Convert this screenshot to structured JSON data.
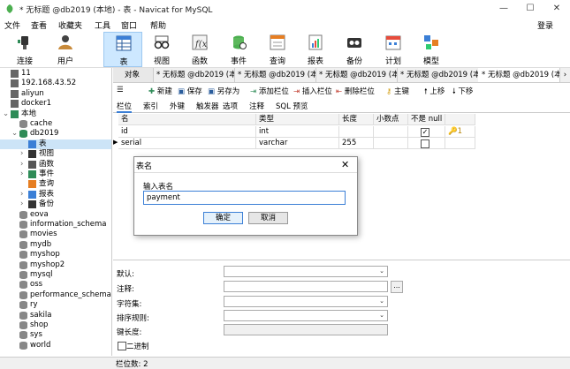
{
  "window": {
    "title": "* 无标题 @db2019 (本地) - 表 - Navicat for MySQL",
    "minimize": "—",
    "maximize": "☐",
    "close": "✕"
  },
  "menu": [
    "文件",
    "查看",
    "收藏夹",
    "工具",
    "窗口",
    "帮助"
  ],
  "login": "登录",
  "toolbar": [
    "连接",
    "用户",
    "表",
    "视图",
    "函数",
    "事件",
    "查询",
    "报表",
    "备份",
    "计划",
    "模型"
  ],
  "tree": [
    {
      "label": "11",
      "indent": 0,
      "icon": "server"
    },
    {
      "label": "192.168.43.52",
      "indent": 0,
      "icon": "server"
    },
    {
      "label": "aliyun",
      "indent": 0,
      "icon": "server"
    },
    {
      "label": "docker1",
      "indent": 0,
      "icon": "server"
    },
    {
      "label": "本地",
      "indent": 0,
      "icon": "server-on",
      "expander": "⌄"
    },
    {
      "label": "cache",
      "indent": 1,
      "icon": "db"
    },
    {
      "label": "db2019",
      "indent": 1,
      "icon": "db-on",
      "expander": "⌄"
    },
    {
      "label": "表",
      "indent": 2,
      "icon": "table",
      "selected": true
    },
    {
      "label": "视图",
      "indent": 2,
      "icon": "view",
      "expander": "›"
    },
    {
      "label": "函数",
      "indent": 2,
      "icon": "func",
      "expander": "›"
    },
    {
      "label": "事件",
      "indent": 2,
      "icon": "event",
      "expander": "›"
    },
    {
      "label": "查询",
      "indent": 2,
      "icon": "query"
    },
    {
      "label": "报表",
      "indent": 2,
      "icon": "report",
      "expander": "›"
    },
    {
      "label": "备份",
      "indent": 2,
      "icon": "backup",
      "expander": "›"
    },
    {
      "label": "eova",
      "indent": 1,
      "icon": "db"
    },
    {
      "label": "information_schema",
      "indent": 1,
      "icon": "db"
    },
    {
      "label": "movies",
      "indent": 1,
      "icon": "db"
    },
    {
      "label": "mydb",
      "indent": 1,
      "icon": "db"
    },
    {
      "label": "myshop",
      "indent": 1,
      "icon": "db"
    },
    {
      "label": "myshop2",
      "indent": 1,
      "icon": "db"
    },
    {
      "label": "mysql",
      "indent": 1,
      "icon": "db"
    },
    {
      "label": "oss",
      "indent": 1,
      "icon": "db"
    },
    {
      "label": "performance_schema",
      "indent": 1,
      "icon": "db"
    },
    {
      "label": "ry",
      "indent": 1,
      "icon": "db"
    },
    {
      "label": "sakila",
      "indent": 1,
      "icon": "db"
    },
    {
      "label": "shop",
      "indent": 1,
      "icon": "db"
    },
    {
      "label": "sys",
      "indent": 1,
      "icon": "db"
    },
    {
      "label": "world",
      "indent": 1,
      "icon": "db"
    }
  ],
  "tabs": [
    {
      "label": "对象",
      "kind": "obj"
    },
    {
      "label": "* 无标题 @db2019 (本地)...",
      "kind": ""
    },
    {
      "label": "* 无标题 @db2019 (本地)...",
      "kind": ""
    },
    {
      "label": "* 无标题 @db2019 (本地)...",
      "kind": ""
    },
    {
      "label": "* 无标题 @db2019 (本地)...",
      "kind": ""
    },
    {
      "label": "* 无标题 @db2019 (本地)...",
      "kind": "act"
    }
  ],
  "design_toolbar": [
    "新建",
    "保存",
    "另存为",
    "添加栏位",
    "插入栏位",
    "删除栏位",
    "主键",
    "上移",
    "下移"
  ],
  "subtabs": [
    "栏位",
    "索引",
    "外键",
    "触发器",
    "选项",
    "注释",
    "SQL 预览"
  ],
  "grid": {
    "headers": [
      "名",
      "类型",
      "长度",
      "小数点",
      "不是 null",
      ""
    ],
    "rows": [
      {
        "name": "id",
        "type": "int",
        "length": "",
        "decimals": "",
        "not_null": true,
        "key": "🔑1",
        "current": false
      },
      {
        "name": "serial",
        "type": "varchar",
        "length": "255",
        "decimals": "",
        "not_null": false,
        "key": "",
        "current": true
      }
    ]
  },
  "props": {
    "default_label": "默认:",
    "comment_label": "注释:",
    "charset_label": "字符集:",
    "collation_label": "排序规则:",
    "keylen_label": "键长度:",
    "binary_label": "二进制",
    "ellipsis": "..."
  },
  "status": "栏位数: 2",
  "dialog": {
    "title": "表名",
    "prompt": "输入表名",
    "value": "payment",
    "ok": "确定",
    "cancel": "取消",
    "close": "✕"
  },
  "colors": {
    "accent": "#3b7fd6",
    "selection": "#cce4f7"
  }
}
